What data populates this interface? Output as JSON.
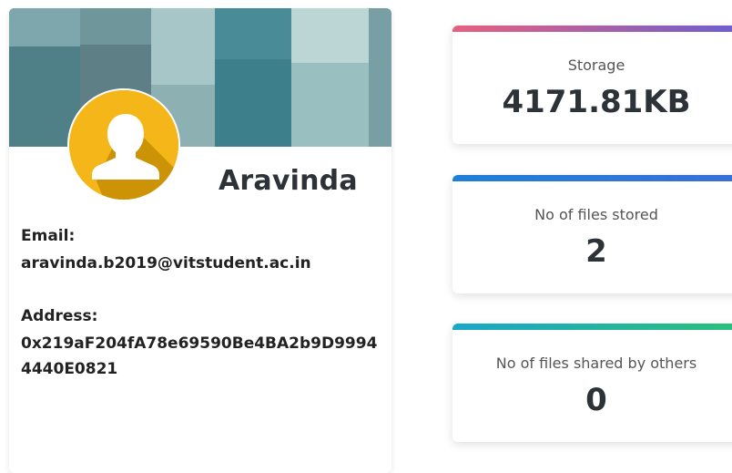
{
  "profile": {
    "name": "Aravinda",
    "email_label": "Email:",
    "email": "aravinda.b2019@vitstudent.ac.in",
    "address_label": "Address:",
    "address": "0x219aF204fA78e69590Be4BA2b9D99944440E0821",
    "avatar_icon": "user-silhouette-icon"
  },
  "stats": [
    {
      "title": "Storage",
      "value": "4171.81KB",
      "gradient": [
        "#e8607e",
        "#6a5fd1"
      ]
    },
    {
      "title": "No of files stored",
      "value": "2",
      "gradient": [
        "#1f7fd6",
        "#3a6fd8"
      ]
    },
    {
      "title": "No of files shared by others",
      "value": "0",
      "gradient": [
        "#1aa6c8",
        "#2bc07a"
      ]
    }
  ],
  "colors": {
    "avatar_bg": "#f4b619",
    "avatar_shadow": "#c98f06",
    "text_dark": "#2d3238"
  }
}
